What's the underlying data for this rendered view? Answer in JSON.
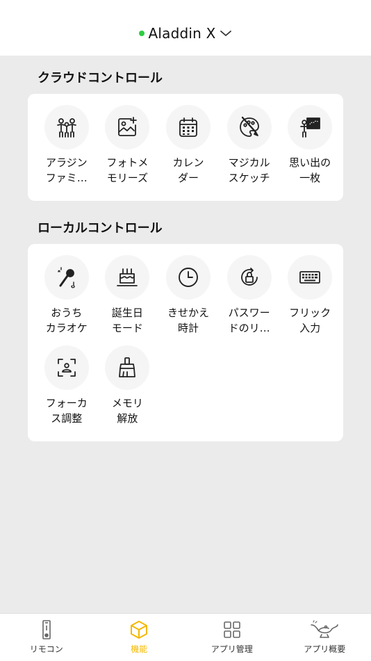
{
  "header": {
    "device_name": "Aladdin X",
    "status_color": "#2ecc40"
  },
  "cloud_section": {
    "title": "クラウドコントロール",
    "items": [
      {
        "label": "アラジン\nファミ…",
        "icon": "family-icon"
      },
      {
        "label": "フォトメ\nモリーズ",
        "icon": "photo-add-icon"
      },
      {
        "label": "カレン\nダー",
        "icon": "calendar-icon"
      },
      {
        "label": "マジカル\nスケッチ",
        "icon": "palette-icon"
      },
      {
        "label": "思い出の\n一枚",
        "icon": "memory-board-icon"
      }
    ]
  },
  "local_section": {
    "title": "ローカルコントロール",
    "items": [
      {
        "label": "おうち\nカラオケ",
        "icon": "microphone-icon"
      },
      {
        "label": "誕生日\nモード",
        "icon": "cake-icon"
      },
      {
        "label": "きせかえ\n時計",
        "icon": "clock-icon"
      },
      {
        "label": "パスワー\nドのリ…",
        "icon": "lock-rotate-icon"
      },
      {
        "label": "フリック\n入力",
        "icon": "keyboard-icon"
      },
      {
        "label": "フォーカ\nス調整",
        "icon": "focus-icon"
      },
      {
        "label": "メモリ\n解放",
        "icon": "broom-icon"
      }
    ]
  },
  "tabbar": {
    "accent_color": "#f5b800",
    "tabs": [
      {
        "label": "リモコン",
        "icon": "remote-icon",
        "active": false
      },
      {
        "label": "機能",
        "icon": "cube-icon",
        "active": true
      },
      {
        "label": "アプリ管理",
        "icon": "app-grid-icon",
        "active": false
      },
      {
        "label": "アプリ概要",
        "icon": "genie-lamp-icon",
        "active": false
      }
    ]
  }
}
